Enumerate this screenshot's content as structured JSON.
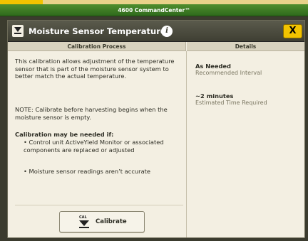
{
  "window": {
    "title": "4600 CommandCenter™"
  },
  "dialog": {
    "title": "Moisture Sensor Temperature",
    "info_icon": "info-icon",
    "close_label": "X",
    "header_icon": "calibrate-icon",
    "header_icon_text": "CAL"
  },
  "columns": {
    "left_title": "Calibration Process",
    "right_title": "Details"
  },
  "process": {
    "intro": "This calibration allows adjustment of the temperature sensor that is part of the moisture sensor system to better match the actual temperature.",
    "note": "NOTE: Calibrate before harvesting begins when the moisture sensor is empty.",
    "heading": "Calibration may be needed if:",
    "bullets": [
      "• Control unit ActiveYield Monitor or associated components are replaced or adjusted",
      "• Moisture sensor readings aren’t accurate"
    ]
  },
  "calibrate_button": {
    "label": "Calibrate",
    "icon_text": "CAL"
  },
  "details": [
    {
      "value": "As Needed",
      "label": "Recommended Interval"
    },
    {
      "value": "~2 minutes",
      "label": "Estimated Time Required"
    }
  ],
  "colors": {
    "accent_yellow": "#f2c300",
    "titlebar_green": "#3f7a25",
    "panel_bg": "#f3efe2"
  }
}
